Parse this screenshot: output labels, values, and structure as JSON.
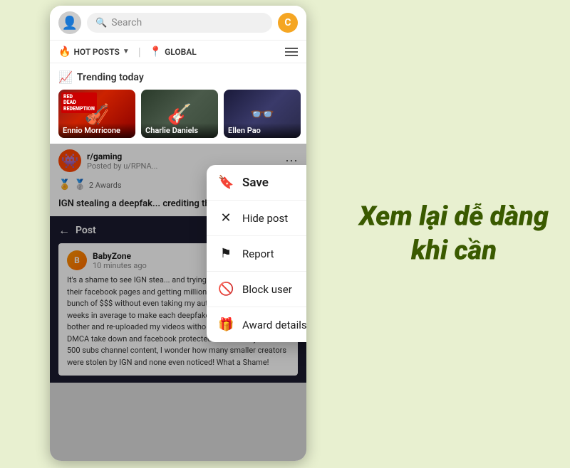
{
  "header": {
    "search_placeholder": "Search",
    "coin_symbol": "C"
  },
  "nav": {
    "hot_posts": "HOT POSTS",
    "location": "GLOBAL"
  },
  "trending": {
    "title": "Trending today",
    "cards": [
      {
        "label": "Ennio Morricone",
        "logo": "RED\nDEAD\nREDEMPTION",
        "type": "ennio"
      },
      {
        "label": "Charlie Daniels",
        "type": "charlie"
      },
      {
        "label": "Ellen Pao",
        "type": "ellen"
      }
    ]
  },
  "post": {
    "subreddit": "r/gaming",
    "posted_by": "Posted by u/RPNA...",
    "awards_count": "2 Awards",
    "title": "IGN stealing a deepfak...\ncrediting the artist,sm..."
  },
  "inner_post": {
    "back_label": "Post",
    "author": "BabyZone",
    "time": "10 minutes ago",
    "body": "It's a shame to see IGN stea...\nand trying to cut my waterm...\nto their facebook pages and getting million of views\nso making bunch of $$$ without even taking my\nauthorization. I spend 3 weeks in average to make\neach deepfake and they just didnt bother and\nre-uploaded my videos without permission. I filled a\nDMCA take down and facebook protected them! if they\nstole a 500 subs channel content, I wonder how many\nsmaller creators were stolen by IGN and none even\nnoticed! What a Shame!"
  },
  "context_menu": {
    "items": [
      {
        "icon": "bookmark",
        "label": "Save",
        "bold": true
      },
      {
        "icon": "hide",
        "label": "Hide post",
        "bold": false
      },
      {
        "icon": "flag",
        "label": "Report",
        "bold": false
      },
      {
        "icon": "block",
        "label": "Block user",
        "bold": false
      },
      {
        "icon": "award",
        "label": "Award details",
        "bold": false
      }
    ]
  },
  "promo": {
    "line1": "Xem lại dễ dàng",
    "line2": "khi cần"
  }
}
